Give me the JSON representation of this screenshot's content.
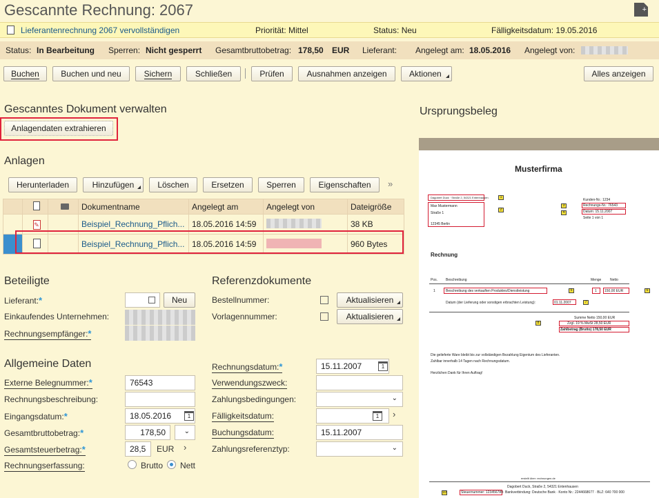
{
  "window": {
    "title": "Gescannte Rechnung: 2067"
  },
  "notice": {
    "task": "Lieferantenrechnung 2067 vervollständigen",
    "priority": "Priorität: Mittel",
    "status": "Status: Neu",
    "due": "Fälligkeitsdatum: 19.05.2016"
  },
  "statusbar": {
    "status_label": "Status:",
    "status_value": "In Bearbeitung",
    "lock_label": "Sperren:",
    "lock_value": "Nicht gesperrt",
    "gross_label": "Gesamtbruttobetrag:",
    "gross_value": "178,50",
    "gross_currency": "EUR",
    "supplier_label": "Lieferant:",
    "created_label": "Angelegt am:",
    "created_value": "18.05.2016",
    "created_by_label": "Angelegt von:"
  },
  "toolbar": {
    "book": "Buchen",
    "book_new": "Buchen und neu",
    "save": "Sichern",
    "close": "Schließen",
    "check": "Prüfen",
    "exceptions": "Ausnahmen anzeigen",
    "actions": "Aktionen",
    "show_all": "Alles anzeigen"
  },
  "scanned": {
    "heading": "Gescanntes Dokument verwalten",
    "extract_button": "Anlagendaten extrahieren"
  },
  "attachments": {
    "heading": "Anlagen",
    "buttons": {
      "download": "Herunterladen",
      "add": "Hinzufügen",
      "delete": "Löschen",
      "replace": "Ersetzen",
      "lock": "Sperren",
      "properties": "Eigenschaften",
      "more": "»"
    },
    "columns": [
      "Dokumentname",
      "Angelegt am",
      "Angelegt von",
      "Dateigröße"
    ],
    "rows": [
      {
        "name": "Beispiel_Rechnung_Pflich...",
        "created": "18.05.2016 14:59",
        "size": "38  KB"
      },
      {
        "name": "Beispiel_Rechnung_Pflich...",
        "created": "18.05.2016 14:59",
        "size": "960  Bytes"
      }
    ]
  },
  "parties": {
    "heading": "Beteiligte",
    "supplier": "Lieferant:",
    "new_button": "Neu",
    "buying_company": "Einkaufendes Unternehmen:",
    "recipient": "Rechnungsempfänger:"
  },
  "references": {
    "heading": "Referenzdokumente",
    "order_no": "Bestellnummer:",
    "template_no": "Vorlagennummer:",
    "update": "Aktualisieren"
  },
  "general": {
    "heading": "Allgemeine Daten",
    "ext_doc_label": "Externe Belegnummer:",
    "ext_doc_value": "76543",
    "desc_label": "Rechnungsbeschreibung:",
    "receipt_label": "Eingangsdatum:",
    "receipt_value": "18.05.2016",
    "gross_label": "Gesamtbruttobetrag:",
    "gross_value": "178,50",
    "tax_label": "Gesamtsteuerbetrag:",
    "tax_value": "28,5",
    "tax_currency": "EUR",
    "entry_label": "Rechnungserfassung:",
    "gross_option": "Brutto",
    "net_option": "Nett",
    "invoice_date_label": "Rechnungsdatum:",
    "invoice_date_value": "15.11.2007",
    "purpose_label": "Verwendungszweck:",
    "terms_label": "Zahlungsbedingungen:",
    "due_label": "Fälligkeitsdatum:",
    "posting_label": "Buchungsdatum:",
    "posting_value": "15.11.2007",
    "payref_label": "Zahlungsreferenztyp:"
  },
  "source": {
    "heading": "Ursprungsbeleg",
    "company": "Musterfirma",
    "sender_line": "Dagobert Duck · Straße 2, 54321 Entenhausen",
    "recipient_name": "Max Mustermann",
    "recipient_street": "Straße 1",
    "recipient_city": "12345 Berlin",
    "customer_no": "Kunden-Nr.: 1234",
    "invoice_no": "Rechnungs-Nr.: 76543",
    "date": "Datum: 15.11.2007",
    "page": "Seite 1 von 1",
    "invoice_title": "Rechnung",
    "col_pos": "Pos.",
    "col_desc": "Beschreibung",
    "col_qty": "Menge",
    "col_net": "Netto",
    "item_pos": "1",
    "item_desc": "Beschreibung des verkauften Produktes/Dienstleistung",
    "item_qty": "1",
    "item_net": "150,00 EUR",
    "delivery_label": "Datum (der Lieferung oder sonstigen erbrachten Leistung):",
    "delivery_value": "01.11.2007",
    "sum_net": "Summe Netto      150,00 EUR",
    "vat": "Zzgl. 19 % MwSt       28,50 EUR",
    "total": "Zahlbetrag (Brutto)    178,50 EUR",
    "note1": "Die gelieferte Ware bleibt bis zur vollständigen Bezahlung Eigentum des Lieferanten.",
    "note2": "Zahlbar innerhalb 14 Tagen nach Rechnungsdatum.",
    "thanks": "Herzlichen Dank für Ihren Auftrag!",
    "footer_url": "erstellt über: rechnungen.de",
    "footer_addr": "Dagobert Duck, Straße 2, 54321 Entenhausen",
    "footer_tax": "Steuernummer: 123456789",
    "footer_bank": " · Bankverbindung: Deutsche Bank · Konto Nr.: 2244668677 · BLZ: 640 700 000",
    "markers": [
      "1",
      "2",
      "3",
      "4",
      "5",
      "6",
      "7",
      "8",
      "9",
      "10"
    ]
  }
}
